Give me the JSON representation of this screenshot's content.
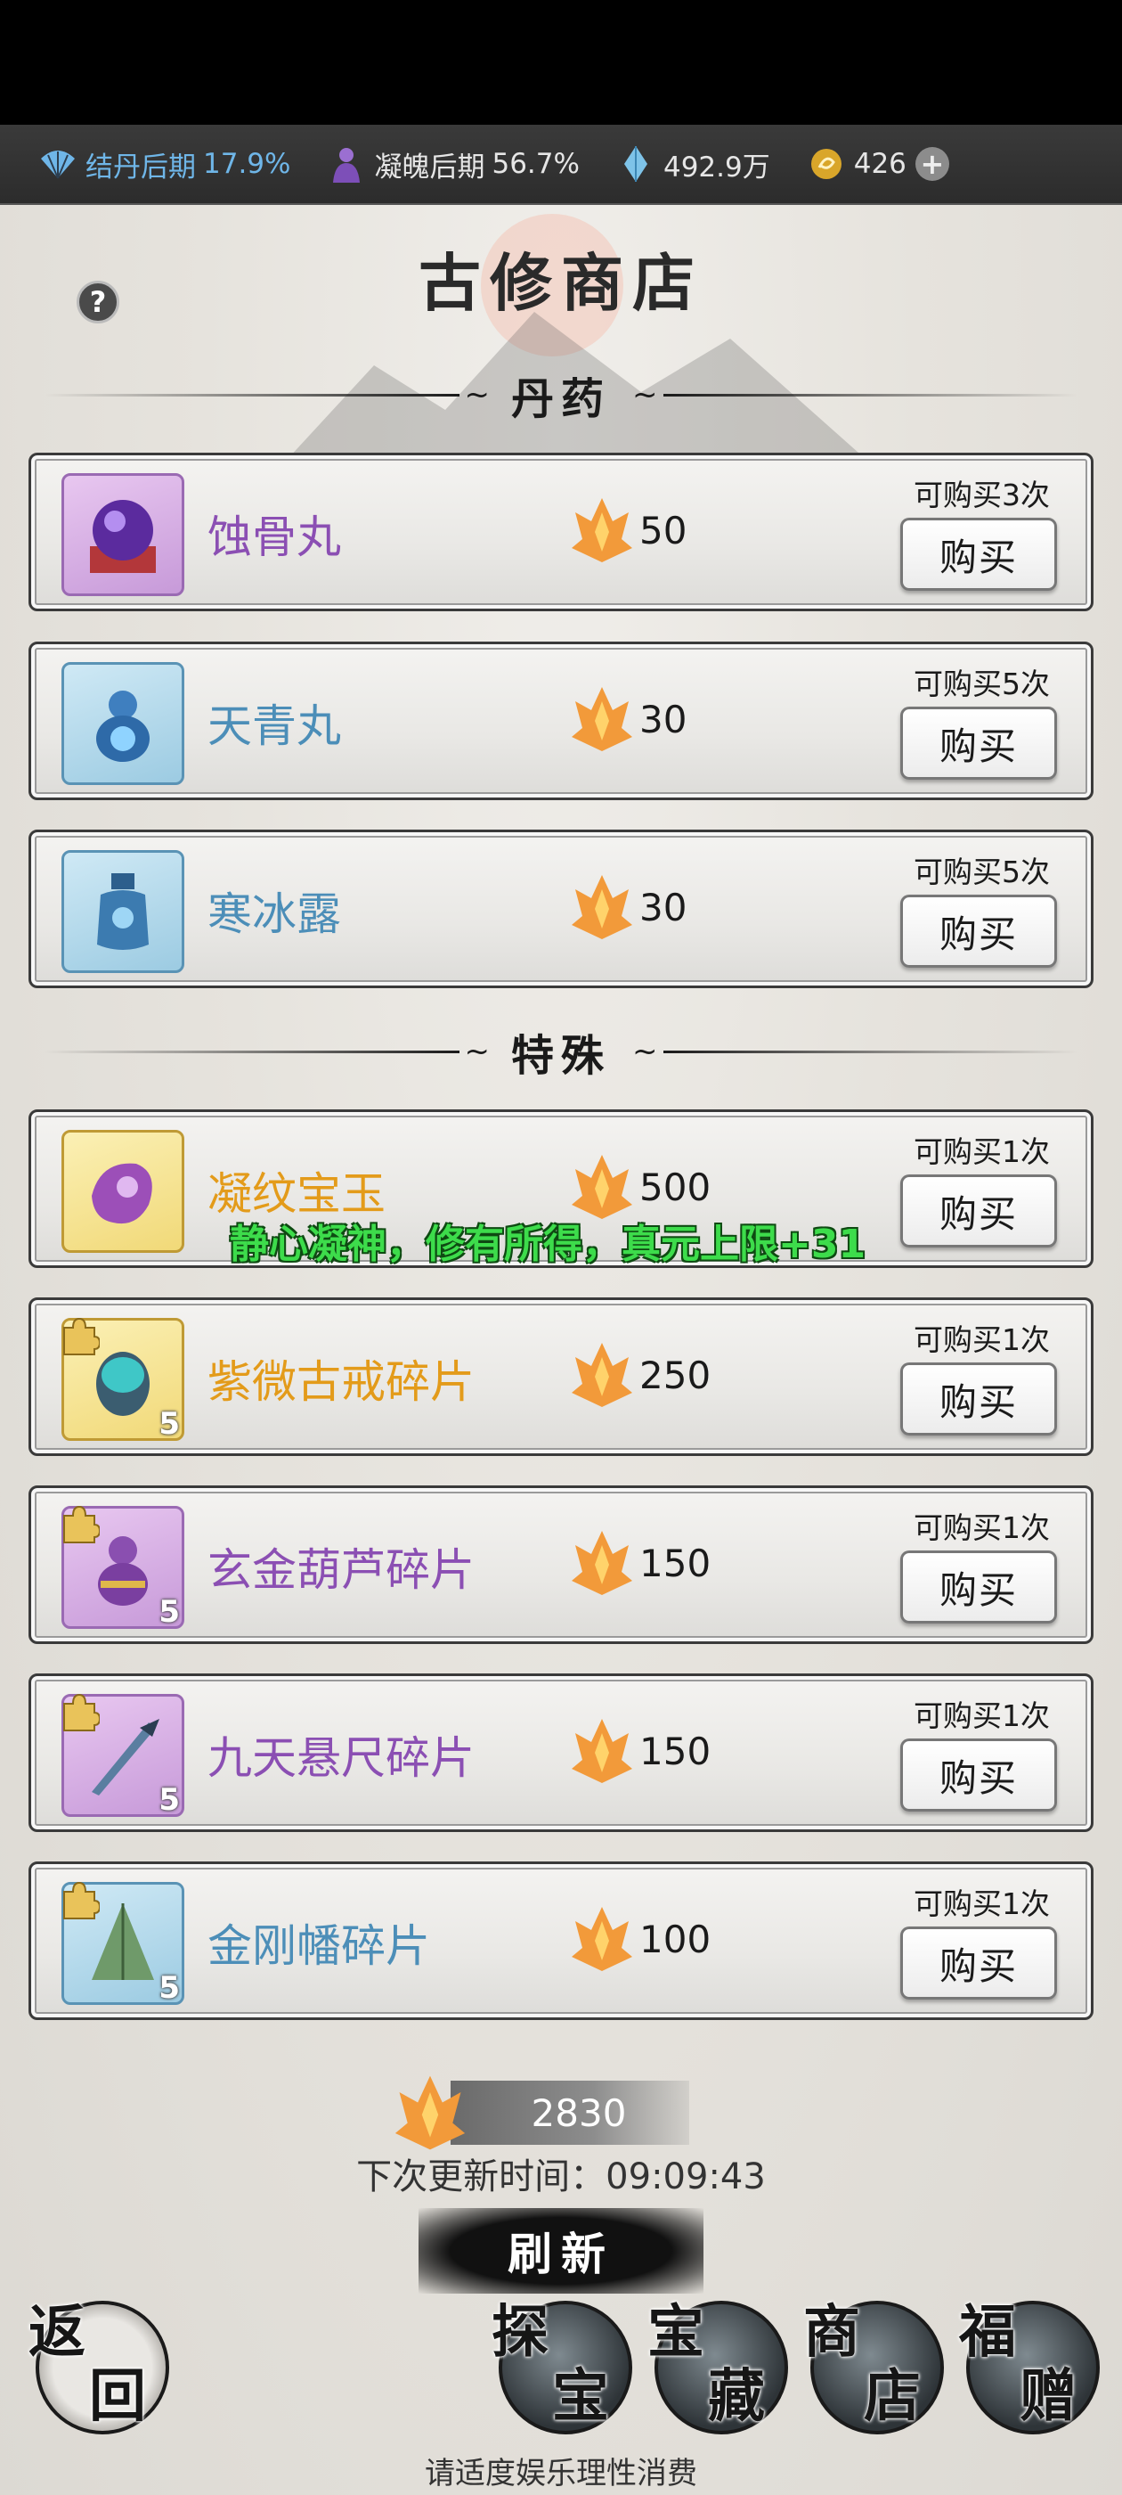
{
  "resources": {
    "cultivation": {
      "label": "结丹后期",
      "value": "17.9%"
    },
    "soul": {
      "label": "凝魄后期",
      "value": "56.7%"
    },
    "spirit_stone": {
      "value": "492.9万"
    },
    "gold": {
      "value": "426"
    },
    "plus": "+"
  },
  "shop": {
    "title": "古修商店",
    "help": "?",
    "sections": {
      "pills": "丹药",
      "special": "特殊"
    },
    "buy_label": "购买",
    "items": [
      {
        "name": "蚀骨丸",
        "price": "50",
        "limit": "可购买3次",
        "rarity": "purple"
      },
      {
        "name": "天青丸",
        "price": "30",
        "limit": "可购买5次",
        "rarity": "blue"
      },
      {
        "name": "寒冰露",
        "price": "30",
        "limit": "可购买5次",
        "rarity": "blue"
      },
      {
        "name": "凝纹宝玉",
        "price": "500",
        "limit": "可购买1次",
        "rarity": "orange"
      },
      {
        "name": "紫微古戒碎片",
        "price": "250",
        "limit": "可购买1次",
        "rarity": "orange",
        "count": "5"
      },
      {
        "name": "玄金葫芦碎片",
        "price": "150",
        "limit": "可购买1次",
        "rarity": "purple",
        "count": "5"
      },
      {
        "name": "九天悬尺碎片",
        "price": "150",
        "limit": "可购买1次",
        "rarity": "purple",
        "count": "5"
      },
      {
        "name": "金刚幡碎片",
        "price": "100",
        "limit": "可购买1次",
        "rarity": "blue",
        "count": "5"
      }
    ],
    "toast": "静心凝神，修有所得，真元上限+31",
    "balance": "2830",
    "next_refresh": "下次更新时间：09:09:43",
    "refresh": "刷新"
  },
  "nav": {
    "back": [
      "返",
      "回"
    ],
    "explore": [
      "探",
      "宝"
    ],
    "treasury": [
      "宝",
      "藏"
    ],
    "store": [
      "商",
      "店"
    ],
    "gift": [
      "福",
      "赠"
    ]
  },
  "footer": "请适度娱乐理性消费",
  "colors": {
    "purple": "#8b4fb3",
    "blue": "#4c8eb8",
    "orange": "#e39b1a",
    "toast": "#3ddc4b"
  }
}
